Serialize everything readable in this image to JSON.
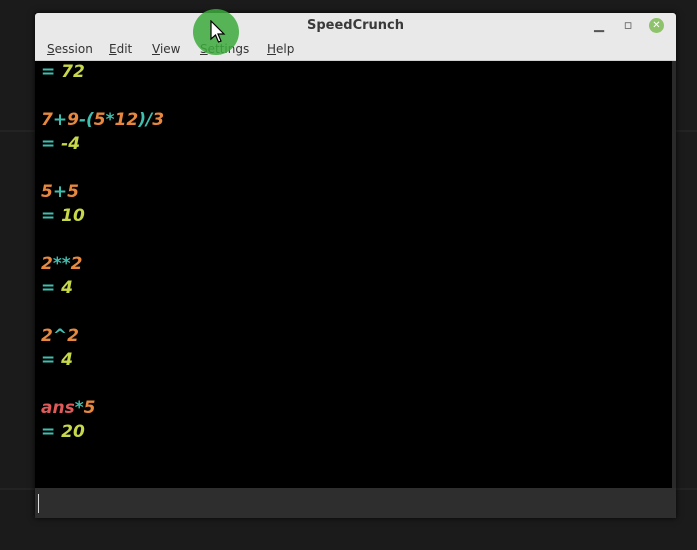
{
  "window": {
    "title": "SpeedCrunch"
  },
  "menu": {
    "items": [
      {
        "first": "S",
        "rest": "ession"
      },
      {
        "first": "E",
        "rest": "dit"
      },
      {
        "first": "V",
        "rest": "iew"
      },
      {
        "first": "S",
        "rest": "ettings"
      },
      {
        "first": "H",
        "rest": "elp"
      }
    ]
  },
  "history": {
    "partial_result": "72",
    "entries": [
      {
        "expr": [
          "7",
          "+",
          "9",
          "-",
          "(",
          "5",
          "*",
          "12",
          ")",
          "/",
          "3"
        ],
        "result": "-4"
      },
      {
        "expr": [
          "5",
          "+",
          "5"
        ],
        "result": "10"
      },
      {
        "expr": [
          "2",
          "**",
          "2"
        ],
        "result": "4"
      },
      {
        "expr": [
          "2",
          "^",
          "2"
        ],
        "result": "4"
      },
      {
        "expr": [
          "ans",
          "*",
          "5"
        ],
        "result": "20"
      }
    ],
    "equals_sign": "="
  },
  "input": {
    "value": ""
  },
  "colors": {
    "number": "#e8883e",
    "operator": "#3fbfb0",
    "result": "#c7d84a",
    "function": "#e05a5a",
    "cursor_highlight": "#3caa3c"
  },
  "icons": {
    "minimize": "minimize-icon",
    "maximize": "maximize-icon",
    "close": "close-icon",
    "pointer": "mouse-pointer-icon"
  }
}
